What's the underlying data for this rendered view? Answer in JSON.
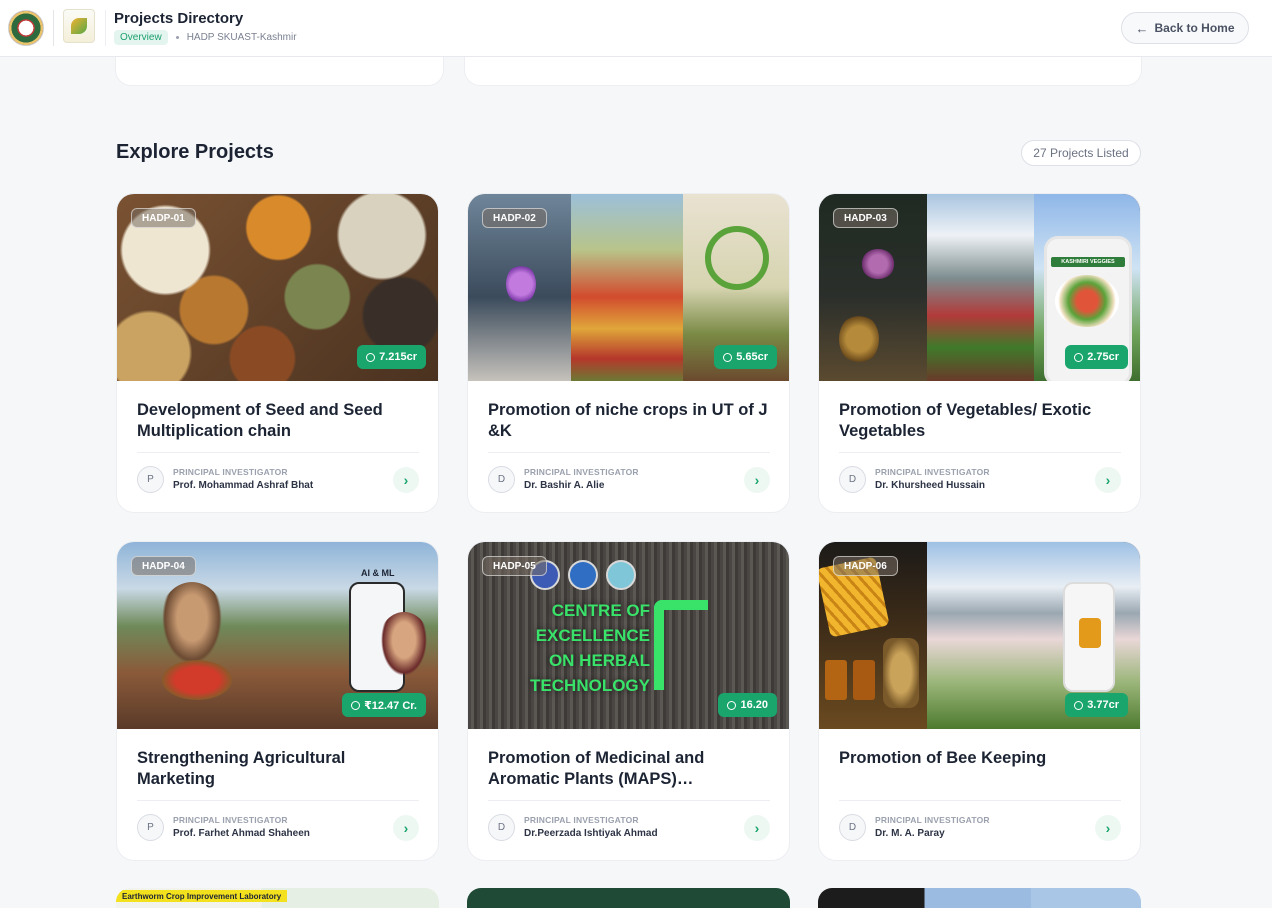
{
  "header": {
    "title": "Projects Directory",
    "overview_tag": "Overview",
    "org": "HADP SKUAST-Kashmir",
    "back_label": "Back to Home",
    "back_icon": "arrow-left-icon"
  },
  "section": {
    "title": "Explore Projects",
    "count_label": "27 Projects Listed"
  },
  "pi_label": "PRINCIPAL INVESTIGATOR",
  "projects": [
    {
      "code": "HADP-01",
      "budget": "7.215cr",
      "title": "Development of Seed and Seed Multiplication chain",
      "initial": "P",
      "pi": "Prof. Mohammad Ashraf Bhat"
    },
    {
      "code": "HADP-02",
      "budget": "5.65cr",
      "title": "Promotion of niche crops in UT of J &K",
      "initial": "D",
      "pi": "Dr. Bashir A. Alie"
    },
    {
      "code": "HADP-03",
      "budget": "2.75cr",
      "title": "Promotion of Vegetables/ Exotic Vegetables",
      "initial": "D",
      "pi": "Dr. Khursheed Hussain"
    },
    {
      "code": "HADP-04",
      "budget": "₹12.47 Cr.",
      "title": "Strengthening Agricultural Marketing",
      "initial": "P",
      "pi": "Prof. Farhet Ahmad Shaheen"
    },
    {
      "code": "HADP-05",
      "budget": "16.20",
      "title": "Promotion of Medicinal and Aromatic Plants (MAPS)…",
      "initial": "D",
      "pi": "Dr.Peerzada Ishtiyak Ahmad"
    },
    {
      "code": "HADP-06",
      "budget": "3.77cr",
      "title": "Promotion of Bee Keeping",
      "initial": "D",
      "pi": "Dr. M. A. Paray"
    }
  ],
  "image_text": {
    "p4_badge": "AI & ML",
    "p5_sign": [
      "CENTRE OF",
      "EXCELLENCE",
      "ON HERBAL",
      "TECHNOLOGY"
    ],
    "p3_phone": "KASHMIRI VEGGIES",
    "bottom_strip": "Earthworm Crop Improvement Laboratory"
  }
}
